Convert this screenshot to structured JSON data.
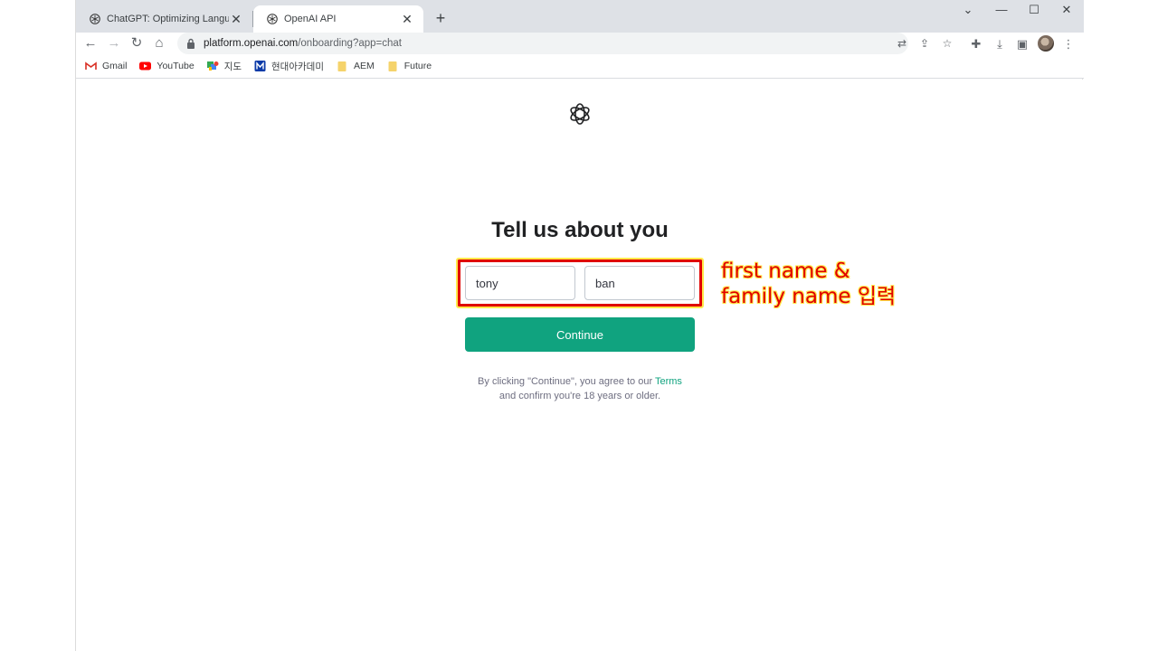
{
  "browser": {
    "tabs": [
      {
        "title": "ChatGPT: Optimizing Language",
        "active": false
      },
      {
        "title": "OpenAI API",
        "active": true
      }
    ],
    "new_tab_symbol": "+",
    "url_host": "platform.openai.com",
    "url_path": "/onboarding?app=chat",
    "bookmarks": [
      {
        "label": "Gmail",
        "icon": "gmail-icon"
      },
      {
        "label": "YouTube",
        "icon": "youtube-icon"
      },
      {
        "label": "지도",
        "icon": "maps-icon"
      },
      {
        "label": "현대아카데미",
        "icon": "m-icon"
      },
      {
        "label": "AEM",
        "icon": "folder-icon"
      },
      {
        "label": "Future",
        "icon": "folder-icon"
      }
    ]
  },
  "page": {
    "title": "Tell us about you",
    "first_name_value": "tony",
    "last_name_value": "ban",
    "continue_label": "Continue",
    "legal_line1_prefix": "By clicking \"Continue\", you agree to our ",
    "legal_terms_link": "Terms",
    "legal_line2": "and confirm you're 18 years or older."
  },
  "annotation": {
    "line1": "first name &",
    "line2": "family name 입력",
    "color": "#e00000",
    "outline_color": "#ffe94a"
  },
  "colors": {
    "accent": "#10a37f",
    "tabstrip": "#dee1e6"
  }
}
